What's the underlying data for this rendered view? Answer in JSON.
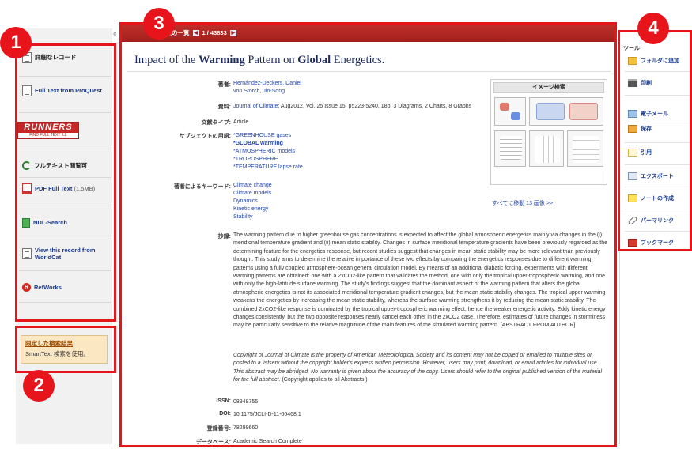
{
  "header": {
    "back_label": "«",
    "search_link_label": "結果の一覧",
    "prev_icon": "triangle-left-icon",
    "position_text": "1 / 43833",
    "next_icon": "triangle-right-icon"
  },
  "left_panel": {
    "items": [
      {
        "label": "詳細なレコード",
        "icon": "record-icon"
      },
      {
        "label": "Full Text from ProQuest",
        "icon": "document-icon"
      },
      {
        "logo_text": "RUNNERS",
        "logo_sub": "FIND FULL TEXT  ILL",
        "icon": "runners-logo"
      },
      {
        "label": "フルテキスト閲覧可",
        "icon": "fulltext-check-icon"
      },
      {
        "label": "PDF Full Text",
        "size": "(1.5MB)",
        "icon": "pdf-icon"
      },
      {
        "label": "NDL-Search",
        "icon": "ndl-icon"
      },
      {
        "label": "View this record from WorldCat",
        "icon": "worldcat-icon"
      },
      {
        "label": "RefWorks",
        "icon": "refworks-icon"
      }
    ],
    "limited_results": {
      "title": "限定した検索結果",
      "desc": "SmartText 検索を使用。"
    }
  },
  "article": {
    "title_pre": "Impact of the ",
    "title_b1": "Warming",
    "title_mid": " Pattern on ",
    "title_b2": "Global",
    "title_post": " Energetics.",
    "authors_label": "著者:",
    "authors": [
      "Hernández-Deckers, Daniel",
      "von Storch, Jin-Song"
    ],
    "source_label": "資料:",
    "source_journal": "Journal of Climate",
    "source_rest": "; Aug2012, Vol. 25 Issue 15, p5223-5240, 18p, 3 Diagrams, 2 Charts, 8 Graphs",
    "doctype_label": "文献タイプ:",
    "doctype": "Article",
    "subject_label": "サブジェクトの用語:",
    "subjects": [
      "*GREENHOUSE gases",
      "*GLOBAL warming",
      "*ATMOSPHERIC models",
      "*TROPOSPHERE",
      "*TEMPERATURE lapse rate"
    ],
    "keywords_label": "著者によるキーワード:",
    "keywords": [
      "Climate change",
      "Climate models",
      "Dynamics",
      "Kinetic energy",
      "Stability"
    ],
    "abstract_label": "抄録:",
    "abstract": "The warming pattern due to higher greenhouse gas concentrations is expected to affect the global atmospheric energetics mainly via changes in the (i) meridional temperature gradient and (ii) mean static stability. Changes in surface meridional temperature gradients have been previously regarded as the determining feature for the energetics response, but recent studies suggest that changes in mean static stability may be more relevant than previously thought. This study aims to determine the relative importance of these two effects by comparing the energetics responses due to different warming patterns using a fully coupled atmosphere-ocean general circulation model. By means of an additional diabatic forcing, experiments with different warming patterns are obtained: one with a 2xCO2-like pattern that validates the method, one with only the tropical upper-tropospheric warming, and one with only the high-latitude surface warming. The study's findings suggest that the dominant aspect of the warming pattern that alters the global atmospheric energetics is not its associated meridional temperature gradient changes, but the mean static stability changes. The tropical upper warming weakens the energetics by increasing the mean static stability, whereas the surface warming strengthens it by reducing the mean static stability. The combined 2xCO2-like response is dominated by the tropical upper-tropospheric warming effect, hence the weaker energetic activity. Eddy kinetic energy changes consistently, but the two opposite responses nearly cancel each other in the 2xCO2 case. Therefore, estimates of future changes in storminess may be particularly sensitive to the relative magnitude of the main features of the simulated warming pattern. [ABSTRACT FROM AUTHOR]",
    "copyright": "Copyright of Journal of Climate is the property of American Meteorological Society and its content may not be copied or emailed to multiple sites or posted to a listserv without the copyright holder's express written permission. However, users may print, download, or email articles for individual use. This abstract may be abridged. No warranty is given about the accuracy of the copy. Users should refer to the original published version of the material for the full abstract.",
    "copyright_tail": " (Copyright applies to all Abstracts.)",
    "issn_label": "ISSN:",
    "issn": "08948755",
    "doi_label": "DOI:",
    "doi": "10.1175/JCLI-D-11-00468.1",
    "accession_label": "登録番号:",
    "accession": "78299660",
    "database_label": "データベース:",
    "database": "Academic Search Complete"
  },
  "image_search": {
    "title": "イメージ検索",
    "see_all": "すべてに移動 13 画像 >>"
  },
  "right_panel": {
    "heading": "ツール",
    "items": [
      {
        "label": "フォルダに追加",
        "icon": "folder-icon"
      },
      {
        "label": "印刷",
        "icon": "print-icon"
      },
      {
        "label": "電子メール",
        "icon": "email-icon"
      },
      {
        "label": "保存",
        "icon": "save-icon"
      },
      {
        "label": "引用",
        "icon": "cite-icon"
      },
      {
        "label": "エクスポート",
        "icon": "export-icon"
      },
      {
        "label": "ノートの作成",
        "icon": "note-icon"
      },
      {
        "label": "パーマリンク",
        "icon": "permalink-icon"
      },
      {
        "label": "ブックマーク",
        "icon": "bookmark-icon"
      }
    ]
  },
  "annotations": {
    "badges": [
      "1",
      "2",
      "3",
      "4"
    ],
    "frame_color": "#e8141b"
  },
  "colors": {
    "header_red": "#a31f1b",
    "link_blue": "#2244aa",
    "title_navy": "#1d2b5a"
  }
}
